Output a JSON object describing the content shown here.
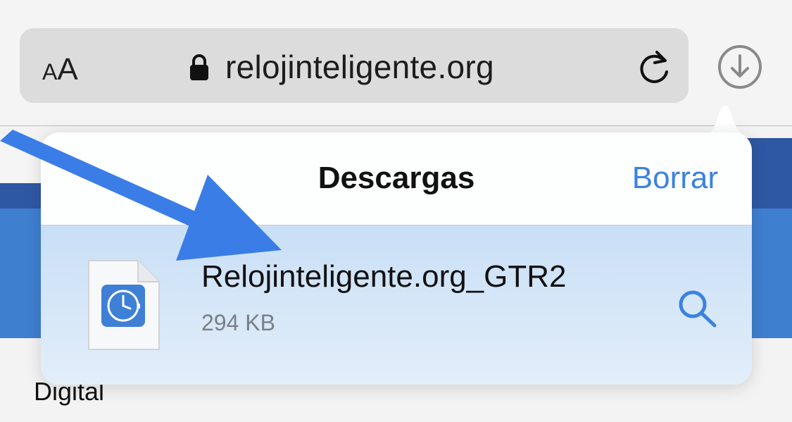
{
  "browser": {
    "text_size_label": {
      "small": "A",
      "big": "A"
    },
    "url": "relojinteligente.org",
    "icons": {
      "lock": "lock-icon",
      "reload": "reload-icon",
      "downloads": "download-circle-icon"
    }
  },
  "page": {
    "partial_text": "Digital"
  },
  "downloads_popover": {
    "title": "Descargas",
    "clear_label": "Borrar",
    "items": [
      {
        "name": "Relojinteligente.org_GTR2",
        "size": "294 KB",
        "icon": "watch-file-icon",
        "action_icon": "magnifier-icon"
      }
    ]
  },
  "colors": {
    "accent": "#3a82e2",
    "row_highlight": "#d0e3f7",
    "annotation_arrow": "#3b7de6"
  }
}
